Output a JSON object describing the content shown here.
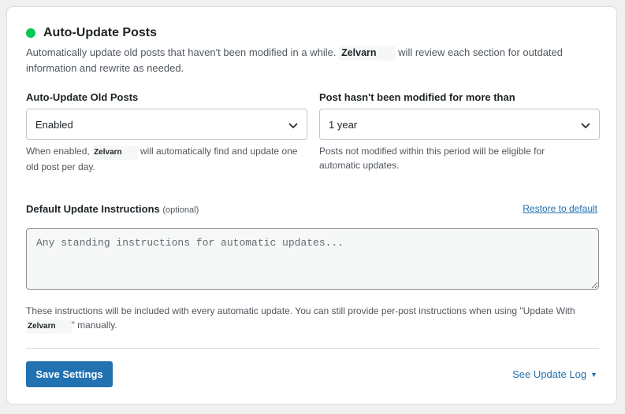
{
  "section": {
    "title": "Auto-Update Posts",
    "status_color": "#00c853",
    "description_before": "Automatically update old posts that haven't been modified in a while.",
    "brand": "Zelvarn",
    "description_after": "will review each section for outdated information and rewrite as needed."
  },
  "auto_update": {
    "label": "Auto-Update Old Posts",
    "value": "Enabled",
    "help_before": "When enabled,",
    "help_after": "will automatically find and update one old post per day."
  },
  "age": {
    "label": "Post hasn't been modified for more than",
    "value": "1 year",
    "help": "Posts not modified within this period will be eligible for automatic updates."
  },
  "instructions": {
    "label": "Default Update Instructions",
    "optional": "(optional)",
    "restore": "Restore to default",
    "placeholder": "Any standing instructions for automatic updates...",
    "help_before": "These instructions will be included with every automatic update. You can still provide per-post instructions when using \"Update With",
    "help_after": "\" manually."
  },
  "footer": {
    "save_label": "Save Settings",
    "log_label": "See Update Log",
    "accent": "#2271b1"
  }
}
